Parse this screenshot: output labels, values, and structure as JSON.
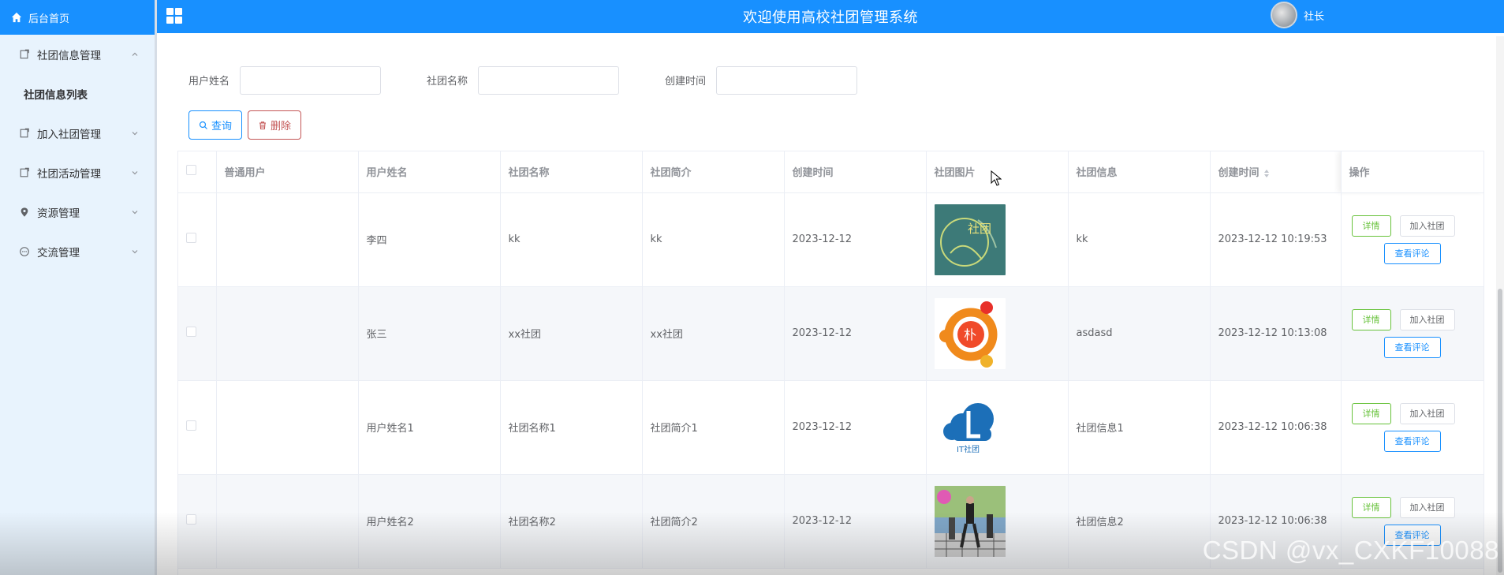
{
  "sidebar": {
    "home": "后台首页",
    "groups": [
      {
        "label": "社团信息管理",
        "expanded": true,
        "icon": "document-icon"
      },
      {
        "label": "加入社团管理",
        "expanded": false,
        "icon": "document-icon"
      },
      {
        "label": "社团活动管理",
        "expanded": false,
        "icon": "document-icon"
      },
      {
        "label": "资源管理",
        "expanded": false,
        "icon": "location-icon"
      },
      {
        "label": "交流管理",
        "expanded": false,
        "icon": "chat-icon"
      }
    ],
    "active_sub_item": "社团信息列表"
  },
  "header": {
    "title": "欢迎使用高校社团管理系统",
    "username": "社长"
  },
  "search": {
    "fields": [
      {
        "label": "用户姓名",
        "value": ""
      },
      {
        "label": "社团名称",
        "value": ""
      },
      {
        "label": "创建时间",
        "value": ""
      }
    ],
    "query_button": "查询",
    "delete_button": "删除"
  },
  "table": {
    "headers": [
      "普通用户",
      "用户姓名",
      "社团名称",
      "社团简介",
      "创建时间",
      "社团图片",
      "社团信息",
      "创建时间",
      "操作"
    ],
    "rows": [
      {
        "normal_user": "",
        "user_name": "李四",
        "club_name": "kk",
        "club_intro": "kk",
        "created_date": "2023-12-12",
        "image": "club-logo-green",
        "club_info": "kk",
        "created_time": "2023-12-12 10:19:53"
      },
      {
        "normal_user": "",
        "user_name": "张三",
        "club_name": "xx社团",
        "club_intro": "xx社团",
        "created_date": "2023-12-12",
        "image": "club-logo-orange",
        "club_info": "asdasd",
        "created_time": "2023-12-12 10:13:08"
      },
      {
        "normal_user": "",
        "user_name": "用户姓名1",
        "club_name": "社团名称1",
        "club_intro": "社团简介1",
        "created_date": "2023-12-12",
        "image": "club-logo-cloud",
        "club_info": "社团信息1",
        "created_time": "2023-12-12 10:06:38"
      },
      {
        "normal_user": "",
        "user_name": "用户姓名2",
        "club_name": "社团名称2",
        "club_intro": "社团简介2",
        "created_date": "2023-12-12",
        "image": "club-photo-dance",
        "club_info": "社团信息2",
        "created_time": "2023-12-12 10:06:38"
      }
    ],
    "ops": {
      "detail": "详情",
      "join": "加入社团",
      "comments": "查看评论"
    },
    "image_caption_cloud": "IT社团",
    "image_caption_green": "社团"
  },
  "watermark": "CSDN @vx_CXKF10088",
  "colors": {
    "primary": "#1890ff",
    "success": "#67c23a",
    "danger": "#c45656",
    "sidebar_bg": "#e8f3fd",
    "stripe": "#f5f7fa"
  }
}
